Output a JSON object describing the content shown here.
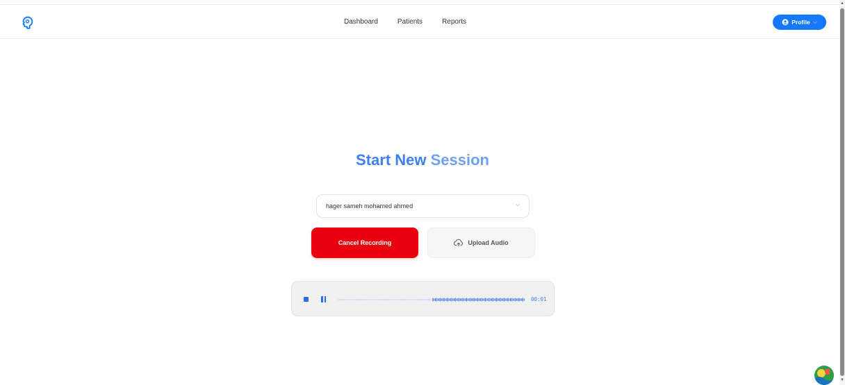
{
  "nav": {
    "items": [
      {
        "label": "Dashboard"
      },
      {
        "label": "Patients"
      },
      {
        "label": "Reports"
      }
    ]
  },
  "profile": {
    "label": "Profile",
    "icon": "user-circle-icon"
  },
  "page": {
    "title_part1": "Start New",
    "title_part2": " Session"
  },
  "patient_select": {
    "value": "hager sameh mohamed ahmed",
    "icon": "chevron-down-icon"
  },
  "actions": {
    "cancel_label": "Cancel Recording",
    "upload_label": "Upload Audio",
    "upload_icon": "cloud-upload-icon"
  },
  "recorder": {
    "timer": "00:01"
  },
  "colors": {
    "brand": "#1677ff",
    "title": "#3f8ef3",
    "danger": "#e9000c"
  }
}
